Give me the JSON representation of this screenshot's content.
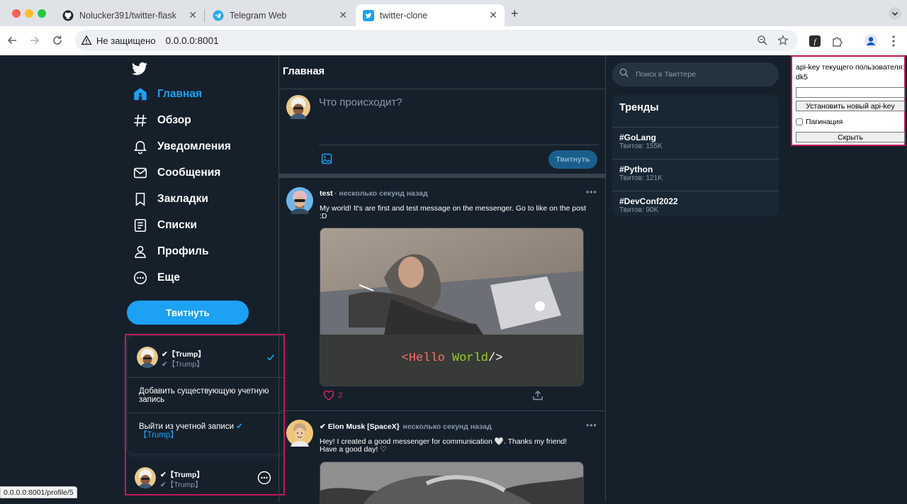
{
  "browser": {
    "tabs": [
      {
        "title": "Nolucker391/twitter-flask",
        "icon": "github-icon"
      },
      {
        "title": "Telegram Web",
        "icon": "telegram-icon"
      },
      {
        "title": "twitter-clone",
        "icon": "twitter-icon",
        "active": true
      }
    ],
    "security_label": "Не защищено",
    "url": "0.0.0.0:8001",
    "status_url": "0.0.0.0:8001/profile/5"
  },
  "sidebar": {
    "items": [
      {
        "label": "Главная",
        "icon": "home-icon",
        "active": true
      },
      {
        "label": "Обзор",
        "icon": "hashtag-icon"
      },
      {
        "label": "Уведомления",
        "icon": "bell-icon"
      },
      {
        "label": "Сообщения",
        "icon": "mail-icon"
      },
      {
        "label": "Закладки",
        "icon": "bookmark-icon"
      },
      {
        "label": "Списки",
        "icon": "list-icon"
      },
      {
        "label": "Профиль",
        "icon": "user-icon"
      },
      {
        "label": "Еще",
        "icon": "more-icon"
      }
    ],
    "tweet_button": "Твитнуть"
  },
  "account_popup": {
    "name": "✔【Trump】",
    "handle": "✔【Trump】",
    "add_account": "Добавить существующую учетную запись",
    "logout_prefix": "Выйти из учетной записи",
    "logout_user": "✔【Trump】"
  },
  "current_account": {
    "name": "✔【Trump】",
    "handle": "✔【Trump】"
  },
  "main": {
    "title": "Главная",
    "compose_placeholder": "Что происходит?",
    "compose_button": "Твитнуть",
    "tweets": [
      {
        "author": "test",
        "time": "· несколько секунд назад",
        "text": "My world! It's are first and test message on the messenger. Go to like on the post :D",
        "media_caption": "<Hello World/>",
        "likes": "2"
      },
      {
        "author": "✔ Elon Musk [SpaceX]",
        "time": "· несколько секунд назад",
        "text": "Hey! I created a good messenger for communication 🤍. Thanks my friend! Have a good day! ♡"
      }
    ]
  },
  "right": {
    "search_placeholder": "Поиск в Твиттере",
    "trends_title": "Тренды",
    "trends": [
      {
        "tag": "#GoLang",
        "count": "Твитов: 155K"
      },
      {
        "tag": "#Python",
        "count": "Твитов: 121K"
      },
      {
        "tag": "#DevConf2022",
        "count": "Твитов: 90K"
      }
    ]
  },
  "api_panel": {
    "label": "api-key текущего пользователя: dk5",
    "input_value": "",
    "set_button": "Установить новый api-key",
    "pagination_label": "Пагинация",
    "pagination_checked": false,
    "hide_button": "Скрыть"
  },
  "colors": {
    "background": "#15202b",
    "accent": "#1da1f2",
    "highlight_border": "#c2185b"
  }
}
